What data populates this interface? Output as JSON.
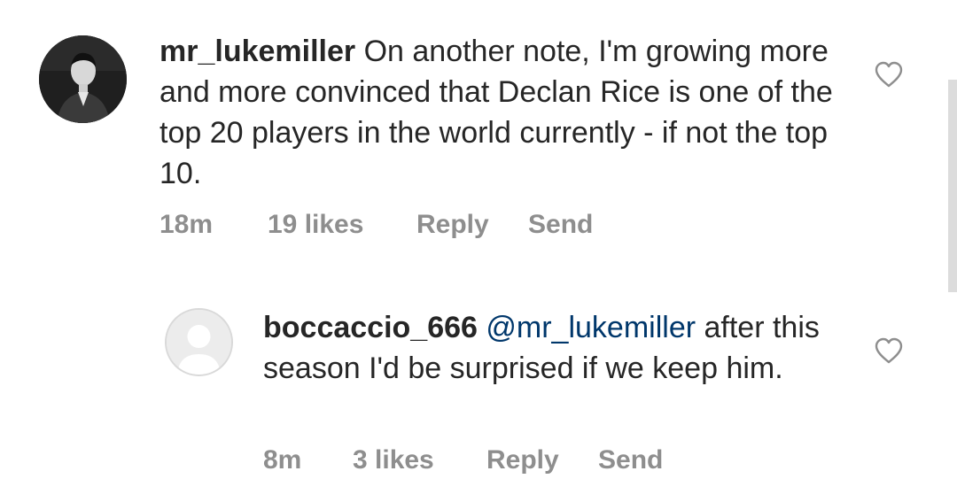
{
  "comments": [
    {
      "username": "mr_lukemiller",
      "text": " On another note, I'm growing more and more convinced that Declan Rice is one of the top 20 players in the world currently - if not the top 10.",
      "time": "18m",
      "likes": "19 likes",
      "reply_label": "Reply",
      "send_label": "Send",
      "like_icon": "heart-outline-icon"
    }
  ],
  "replies": [
    {
      "username": "boccaccio_666",
      "mention": "@mr_lukemiller",
      "text": " after this season I'd be surprised if we keep him.",
      "time": "8m",
      "likes": "3 likes",
      "reply_label": "Reply",
      "send_label": "Send",
      "like_icon": "heart-outline-icon"
    }
  ],
  "colors": {
    "text": "#262626",
    "meta": "#8e8e8e",
    "mention": "#00376b",
    "heart": "#8e8e8e"
  }
}
